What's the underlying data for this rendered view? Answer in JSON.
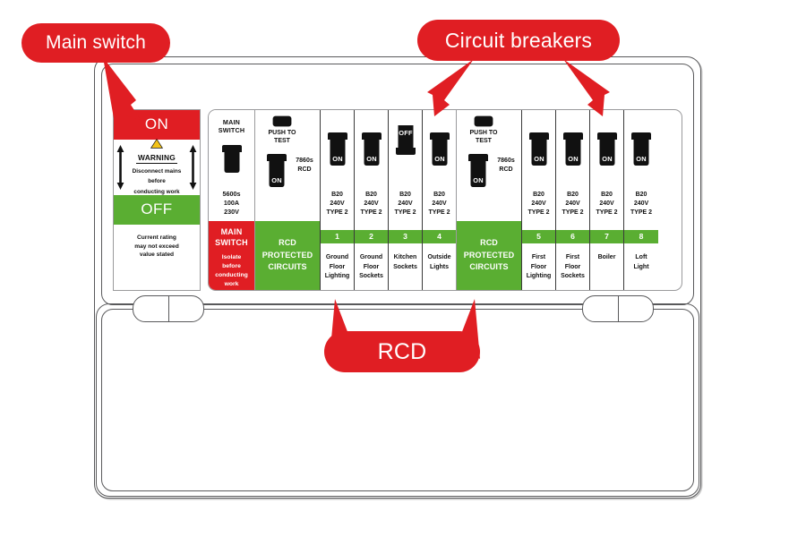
{
  "colors": {
    "red": "#E01E23",
    "green": "#5AAE32",
    "outline": "#59595b",
    "black": "#111111",
    "yellow": "#F3C318"
  },
  "callouts": [
    {
      "id": "main-switch",
      "label": "Main switch"
    },
    {
      "id": "circuit-breakers",
      "label": "Circuit breakers"
    },
    {
      "id": "rcd",
      "label": "RCD"
    }
  ],
  "legend": {
    "on_label": "ON",
    "off_label": "OFF",
    "warning_word": "WARNING",
    "warning_text_line1": "Disconnect mains",
    "warning_text_line2": "before",
    "warning_text_line3": "conducting work",
    "rating_line1": "Current rating",
    "rating_line2": "may not exceed",
    "rating_line3": "value stated",
    "warning_icon": "warning-triangle-icon",
    "arrow_icon": "double-headed-arrow-icon"
  },
  "main_switch": {
    "title_line1": "MAIN",
    "title_line2": "SWITCH",
    "switch_state": "",
    "spec_line1": "5600s",
    "spec_line2": "100A",
    "spec_line3": "230V",
    "band_line1": "MAIN",
    "band_line2": "SWITCH",
    "band_sub_line1": "Isolate",
    "band_sub_line2": "before",
    "band_sub_line3": "conducting",
    "band_sub_line4": "work"
  },
  "rcds": [
    {
      "test_label_line1": "PUSH TO",
      "test_label_line2": "TEST",
      "code_line1": "7860s",
      "code_line2": "RCD",
      "switch_state": "ON",
      "band_line1": "RCD",
      "band_line2": "PROTECTED",
      "band_line3": "CIRCUITS"
    },
    {
      "test_label_line1": "PUSH TO",
      "test_label_line2": "TEST",
      "code_line1": "7860s",
      "code_line2": "RCD",
      "switch_state": "ON",
      "band_line1": "RCD",
      "band_line2": "PROTECTED",
      "band_line3": "CIRCUITS"
    }
  ],
  "breakers_group_a": [
    {
      "number": "1",
      "state": "ON",
      "spec_line1": "B20",
      "spec_line2": "240V",
      "spec_line3": "TYPE 2",
      "label_line1": "Ground",
      "label_line2": "Floor",
      "label_line3": "Lighting"
    },
    {
      "number": "2",
      "state": "ON",
      "spec_line1": "B20",
      "spec_line2": "240V",
      "spec_line3": "TYPE 2",
      "label_line1": "Ground",
      "label_line2": "Floor",
      "label_line3": "Sockets"
    },
    {
      "number": "3",
      "state": "OFF",
      "spec_line1": "B20",
      "spec_line2": "240V",
      "spec_line3": "TYPE 2",
      "label_line1": "Kitchen",
      "label_line2": "Sockets",
      "label_line3": ""
    },
    {
      "number": "4",
      "state": "ON",
      "spec_line1": "B20",
      "spec_line2": "240V",
      "spec_line3": "TYPE 2",
      "label_line1": "Outside",
      "label_line2": "Lights",
      "label_line3": ""
    }
  ],
  "breakers_group_b": [
    {
      "number": "5",
      "state": "ON",
      "spec_line1": "B20",
      "spec_line2": "240V",
      "spec_line3": "TYPE 2",
      "label_line1": "First",
      "label_line2": "Floor",
      "label_line3": "Lighting"
    },
    {
      "number": "6",
      "state": "ON",
      "spec_line1": "B20",
      "spec_line2": "240V",
      "spec_line3": "TYPE 2",
      "label_line1": "First",
      "label_line2": "Floor",
      "label_line3": "Sockets"
    },
    {
      "number": "7",
      "state": "ON",
      "spec_line1": "B20",
      "spec_line2": "240V",
      "spec_line3": "TYPE 2",
      "label_line1": "Boiler",
      "label_line2": "",
      "label_line3": ""
    },
    {
      "number": "8",
      "state": "ON",
      "spec_line1": "B20",
      "spec_line2": "240V",
      "spec_line3": "TYPE 2",
      "label_line1": "Loft",
      "label_line2": "Light",
      "label_line3": ""
    }
  ]
}
